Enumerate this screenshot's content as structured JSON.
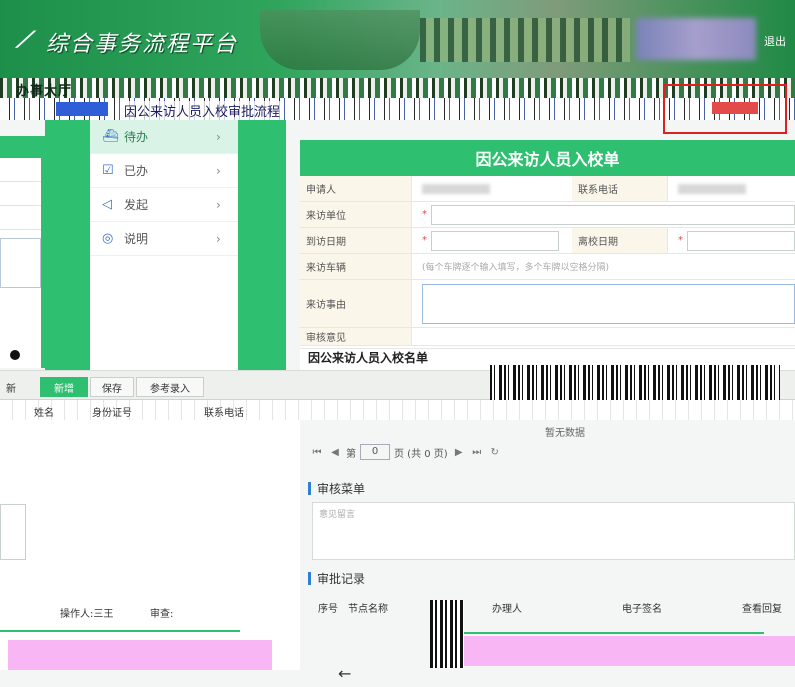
{
  "header": {
    "brand": "综合事务流程平台",
    "exit": "退出"
  },
  "glitch": {
    "band1": "办事大厅",
    "band2": "因公来访人员入校审批流程"
  },
  "menu": {
    "items": [
      {
        "icon": "inbox-icon",
        "glyph": "⛴",
        "label": "待办"
      },
      {
        "icon": "checklist-icon",
        "glyph": "☑",
        "label": "已办"
      },
      {
        "icon": "send-icon",
        "glyph": "◁",
        "label": "发起"
      },
      {
        "icon": "bulb-icon",
        "glyph": "◎",
        "label": "说明"
      }
    ],
    "chevron": "›"
  },
  "form": {
    "title": "因公来访人员入校单",
    "applicant_label": "申请人",
    "phone_label": "联系电话",
    "unit_label": "来访单位",
    "arrive_label": "到访日期",
    "leave_label": "离校日期",
    "vehicle_label": "来访车辆",
    "vehicle_placeholder": "(每个车牌逐个输入填写，多个车牌以空格分隔)",
    "reason_label": "来访事由",
    "opinion_label": "审核意见",
    "required_mark": "*",
    "list_title": "因公来访人员入校名单"
  },
  "toolbar": {
    "left": "新",
    "add": "新增",
    "save": "保存",
    "reference": "参考录入"
  },
  "table": {
    "col1": "姓名",
    "col2": "身份证号",
    "col3": "联系电话"
  },
  "lower_left": {
    "operator": "操作人:三王",
    "approver": "审查:"
  },
  "pager": {
    "no_data": "暂无数据",
    "page_prefix": "第",
    "page_value": "0",
    "page_suffix": "页 (共 0 页)"
  },
  "audit": {
    "title": "审核菜单",
    "placeholder": "意见留言"
  },
  "records": {
    "title": "审批记录",
    "col_seq": "序号",
    "col_node": "节点名称",
    "col_handler": "办理人",
    "col_sign": "电子签名",
    "col_view": "查看回复"
  },
  "nav": {
    "back": "←"
  }
}
